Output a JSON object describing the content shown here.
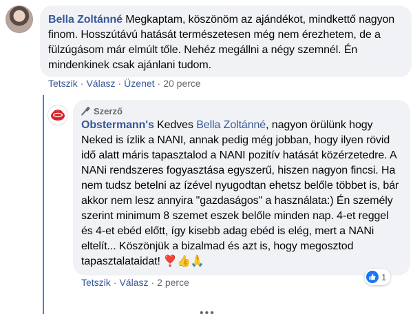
{
  "main_comment": {
    "author": "Bella Zoltánné",
    "text": " Megkaptam, köszönöm az ajándékot, mindkettő nagyon finom. Hosszútávú hatását természetesen még nem érezhetem, de a fülzúgásom már elmúlt tőle. Nehéz megállni a négy szemnél. Én mindenkinek csak ajánlani tudom.",
    "actions": {
      "like": "Tetszik",
      "reply": "Válasz",
      "message": "Üzenet",
      "separator": "·",
      "time": "20 perce"
    }
  },
  "reply_comment": {
    "badge": "Szerző",
    "badge_icon": "microphone-icon",
    "author": "Obstermann's",
    "pre_mention": " Kedves ",
    "mention": "Bella Zoltánné",
    "text": ", nagyon örülünk hogy Neked is ízlik a NANI, annak pedig még jobban, hogy ilyen rövid idő alatt máris tapasztalod a NANI pozitív hatását közérzetedre. A NANi rendszeres fogyasztása egyszerű, hiszen nagyon fincsi. Ha nem tudsz betelni az ízével nyugodtan ehetsz belőle többet is, bár akkor nem lesz annyira \"gazdaságos\" a használata:) Én személy szerint minimum 8 szemet eszek belőle minden nap. 4-et reggel és 4-et ebéd előtt, így kisebb adag ebéd is elég, mert a NANi eltelít... Köszönjük a bizalmad és azt is, hogy megosztod tapasztalataidat! ",
    "emoji": "❣️👍🙏",
    "actions": {
      "like": "Tetszik",
      "reply": "Válasz",
      "separator": "·",
      "time": "2 perce"
    },
    "reactions": {
      "icon": "like-icon",
      "count": "1"
    }
  },
  "more": "•••",
  "colors": {
    "link": "#385898",
    "bubble": "#f0f2f5",
    "thread_line": "#4a7fe0",
    "like_blue": "#1877f2",
    "meta": "#65676b"
  }
}
